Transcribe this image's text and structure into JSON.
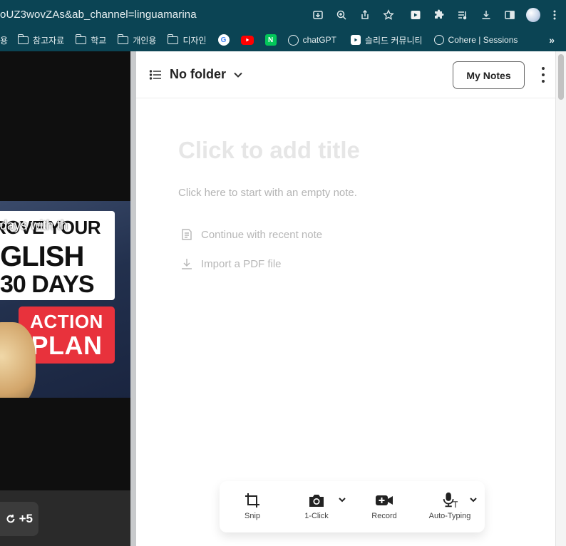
{
  "browser": {
    "url_text": "oUZ3wovZAs&ab_channel=linguamarina",
    "bookmarks": [
      {
        "label": "용",
        "icon": "folder-icon"
      },
      {
        "label": "참고자료",
        "icon": "folder-icon"
      },
      {
        "label": "학교",
        "icon": "folder-icon"
      },
      {
        "label": "개인용",
        "icon": "folder-icon"
      },
      {
        "label": "디자인",
        "icon": "folder-icon"
      },
      {
        "label": "",
        "icon": "google-icon"
      },
      {
        "label": "",
        "icon": "youtube-icon"
      },
      {
        "label": "",
        "icon": "naver-icon"
      },
      {
        "label": "chatGPT",
        "icon": "openai-icon"
      },
      {
        "label": "슬리드 커뮤니티",
        "icon": "slid-icon"
      },
      {
        "label": "Cohere | Sessions",
        "icon": "cohere-icon"
      }
    ],
    "more_bookmarks": "»"
  },
  "video": {
    "caption": "days with th",
    "title_line1": "ROVE YOUR",
    "title_line2": "IGLISH",
    "title_line3": "30 DAYS",
    "badge_line1": "ACTION",
    "badge_line2": "PLAN",
    "skip_label": "+5"
  },
  "notes": {
    "folder_label": "No folder",
    "my_notes_label": "My Notes",
    "title_placeholder": "Click to add title",
    "body_placeholder": "Click here to start with an empty note.",
    "option_recent": "Continue with recent note",
    "option_import": "Import a PDF file"
  },
  "toolbar": {
    "snip": "Snip",
    "one_click": "1-Click",
    "record": "Record",
    "auto_typing": "Auto-Typing"
  },
  "colors": {
    "browser_bar": "#0b4454",
    "action_red": "#e8323c",
    "placeholder_gray": "#e6e6e6"
  }
}
